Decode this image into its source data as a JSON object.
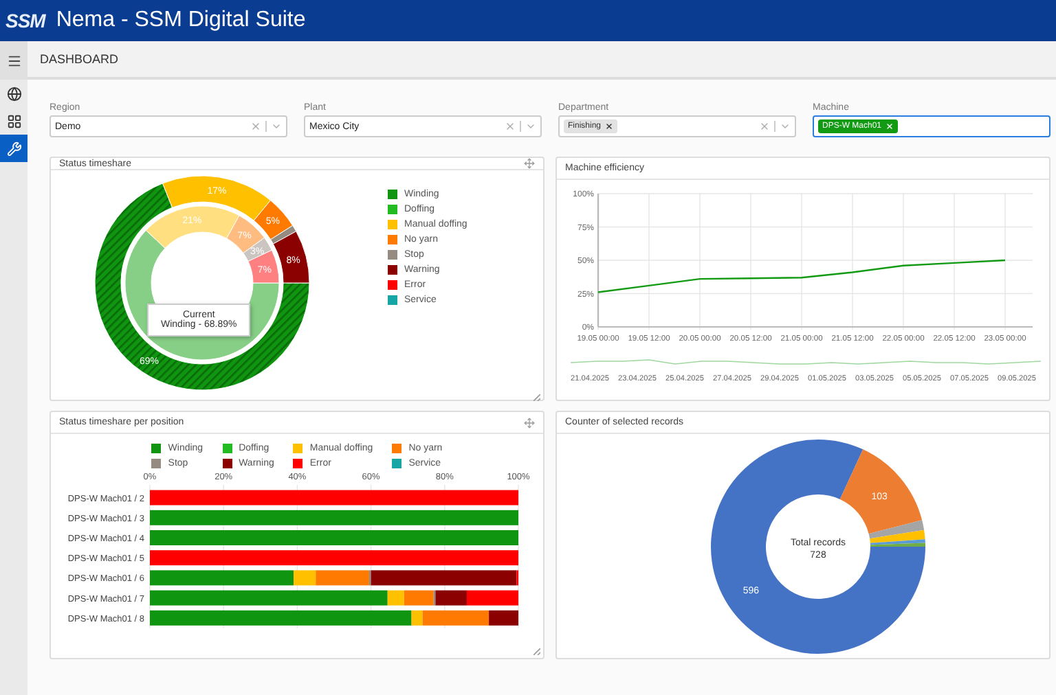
{
  "header": {
    "logo": "SSM",
    "title": "Nema - SSM Digital Suite"
  },
  "breadcrumb": "DASHBOARD",
  "sidebar": {
    "items": [
      {
        "selected": false
      },
      {
        "selected": false
      },
      {
        "selected": true
      }
    ]
  },
  "filters": [
    {
      "label": "Region",
      "value": "Demo",
      "clearable": true,
      "focused": false
    },
    {
      "label": "Plant",
      "value": "Mexico City",
      "clearable": true,
      "focused": false
    },
    {
      "label": "Department",
      "chips": [
        {
          "text": "Finishing",
          "color": "#e2e2e2"
        }
      ],
      "clearable": true,
      "focused": false
    },
    {
      "label": "Machine",
      "chips": [
        {
          "text": "DPS-W Mach01",
          "color": "#129a12"
        }
      ],
      "clearable": false,
      "focused": true
    }
  ],
  "status_timeshare": {
    "title": "Status timeshare",
    "legend": [
      {
        "label": "Winding"
      },
      {
        "label": "Doffing"
      },
      {
        "label": "Manual doffing"
      },
      {
        "label": "No yarn"
      },
      {
        "label": "Stop"
      },
      {
        "label": "Warning"
      },
      {
        "label": "Error"
      },
      {
        "label": "Service"
      }
    ],
    "chart_data": {
      "type": "donut",
      "series": [
        {
          "colors": [
            "#0f950f",
            "#22bb22",
            "#ffc000",
            "#ff7a00",
            "#958b80",
            "#8b0000",
            "#ff0000",
            "#17a6a6"
          ],
          "values": [
            69,
            0,
            17,
            5,
            1,
            8,
            0,
            0
          ],
          "value_labels": [
            "69%",
            null,
            "17%",
            "5%",
            null,
            "8%",
            null,
            null
          ]
        },
        {
          "colors": [
            "#87cf87",
            null,
            "#ffdf80",
            "#ffbc80",
            "#cac5c0",
            null,
            "#ff8080",
            null
          ],
          "values": [
            62,
            0,
            21,
            7,
            3,
            0,
            7,
            0
          ],
          "value_labels": [
            null,
            null,
            "21%",
            "7%",
            "3%",
            null,
            "7%",
            null
          ]
        }
      ]
    },
    "tooltip": {
      "title": "Current",
      "text": "Winding - 68.89%"
    }
  },
  "machine_efficiency": {
    "title": "Machine efficiency",
    "chart_data": {
      "type": "line",
      "categories": [
        "19.05 00:00",
        "19.05 12:00",
        "20.05 00:00",
        "20.05 12:00",
        "21.05 00:00",
        "21.05 12:00",
        "22.05 00:00",
        "22.05 12:00",
        "23.05 00:00"
      ],
      "grid": true,
      "series": [
        {
          "color": "#129a12",
          "values": [
            26,
            31,
            36,
            36.5,
            37,
            41,
            46,
            48,
            50
          ]
        }
      ],
      "ylim": [
        0,
        100
      ],
      "yticks": [
        {
          "value": 0,
          "label": "0%"
        },
        {
          "value": 25,
          "label": "25%"
        },
        {
          "value": 50,
          "label": "50%"
        },
        {
          "value": 75,
          "label": "75%"
        },
        {
          "value": 100,
          "label": "100%"
        }
      ]
    },
    "navigator_dates": [
      "21.04.2025",
      "23.04.2025",
      "25.04.2025",
      "27.04.2025",
      "29.04.2025",
      "01.05.2025",
      "03.05.2025",
      "05.05.2025",
      "07.05.2025",
      "09.05.2025"
    ]
  },
  "per_position": {
    "title": "Status timeshare per position",
    "chart_data": {
      "type": "bar",
      "orientation": "horizontal",
      "stacked": true,
      "grid": true,
      "categories": [
        "DPS-W Mach01 / 2",
        "DPS-W Mach01 / 3",
        "DPS-W Mach01 / 4",
        "DPS-W Mach01 / 5",
        "DPS-W Mach01 / 6",
        "DPS-W Mach01 / 7",
        "DPS-W Mach01 / 8"
      ],
      "series": [
        {
          "name": "Winding",
          "color": "#0f950f",
          "values": [
            0,
            100,
            100,
            0,
            39,
            64.5,
            71
          ]
        },
        {
          "name": "Doffing",
          "color": "#22bb22",
          "values": [
            0,
            0,
            0,
            0,
            0,
            0,
            0
          ]
        },
        {
          "name": "Manual doffing",
          "color": "#ffc000",
          "values": [
            0,
            0,
            0,
            0,
            6,
            4.5,
            3
          ]
        },
        {
          "name": "No yarn",
          "color": "#ff7a00",
          "values": [
            0,
            0,
            0,
            0,
            14.5,
            8,
            18
          ]
        },
        {
          "name": "Stop",
          "color": "#958b80",
          "values": [
            0,
            0,
            0,
            0,
            0.5,
            0.5,
            0
          ]
        },
        {
          "name": "Warning",
          "color": "#8b0000",
          "values": [
            0,
            0,
            0,
            0,
            39.5,
            8.5,
            8
          ]
        },
        {
          "name": "Error",
          "color": "#ff0000",
          "values": [
            100,
            0,
            0,
            100,
            0.5,
            14,
            0
          ]
        },
        {
          "name": "Service",
          "color": "#17a6a6",
          "values": [
            0,
            0,
            0,
            0,
            0,
            0,
            0
          ]
        }
      ],
      "xlim": [
        0,
        100
      ],
      "xticks": [
        {
          "value": 0,
          "label": "0%"
        },
        {
          "value": 20,
          "label": "20%"
        },
        {
          "value": 40,
          "label": "40%"
        },
        {
          "value": 60,
          "label": "60%"
        },
        {
          "value": 80,
          "label": "80%"
        },
        {
          "value": 100,
          "label": "100%"
        }
      ]
    }
  },
  "counter": {
    "title": "Counter of selected records",
    "center_label": "Total records",
    "center_value": "728",
    "slices": [
      {
        "color": "#4472c4"
      },
      {
        "color": "#ed7d31"
      },
      {
        "color": "#a5a5a5"
      },
      {
        "color": "#ffc000"
      },
      {
        "color": "#5b9bd5"
      },
      {
        "color": "#70ad47"
      }
    ],
    "chart_data": {
      "type": "donut",
      "values": [
        596,
        103,
        11,
        10,
        4,
        4
      ],
      "value_labels": [
        "596",
        "103",
        null,
        null,
        null,
        null
      ]
    }
  }
}
